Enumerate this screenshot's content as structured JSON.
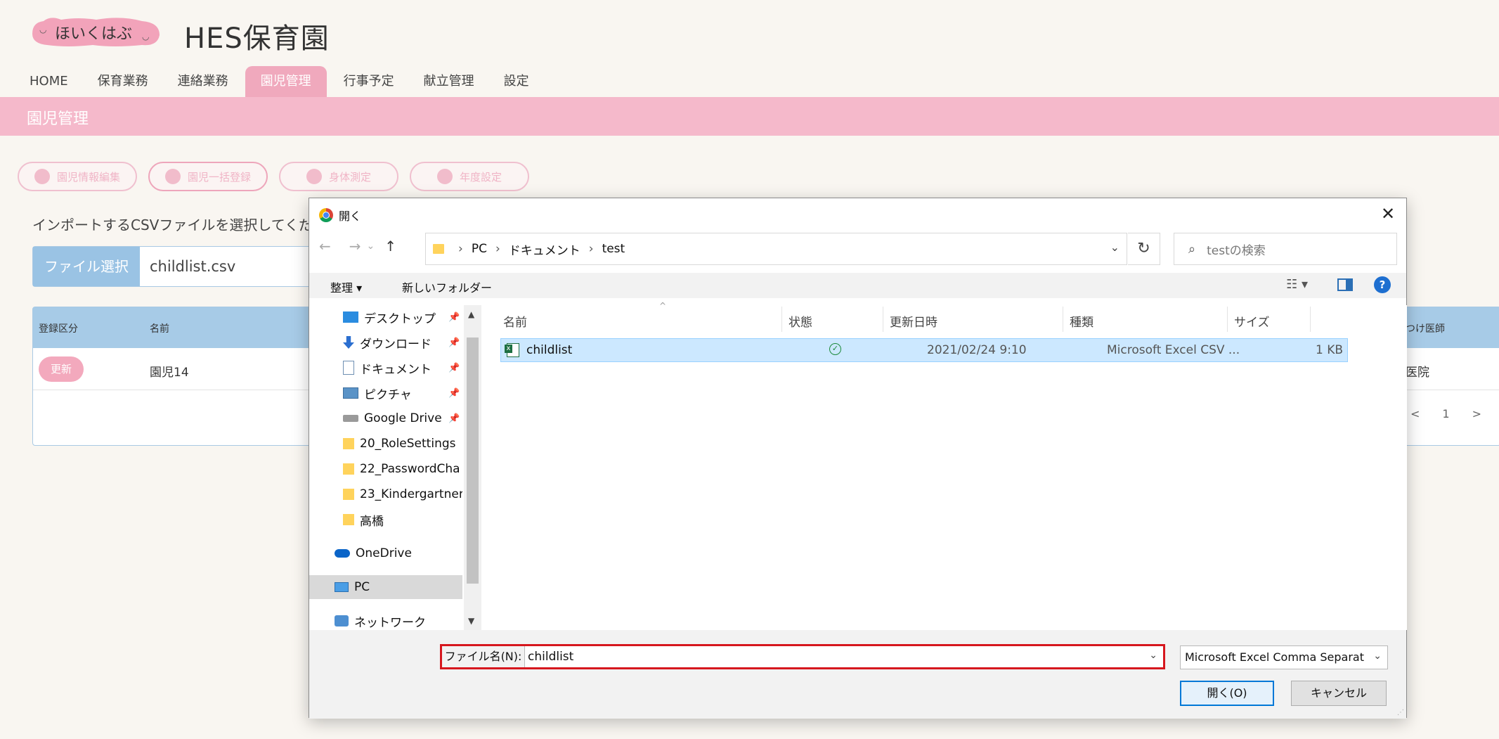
{
  "app": {
    "logo_text": "ほいくはぶ",
    "site_name": "HES保育園",
    "nav": [
      "HOME",
      "保育業務",
      "連絡業務",
      "園児管理",
      "行事予定",
      "献立管理",
      "設定"
    ],
    "active_nav": "園児管理",
    "page_title": "園児管理",
    "subtabs": [
      "園児情報編集",
      "園児一括登録",
      "身体測定",
      "年度設定"
    ],
    "import_message": "インポートするCSVファイルを選択してくだ",
    "file_select_label": "ファイル選択",
    "file_name": "childlist.csv",
    "table": {
      "headers": [
        "登録区分",
        "名前",
        "つけ医師"
      ],
      "row": {
        "badge": "更新",
        "name": "園児14",
        "doctor": "医院"
      }
    },
    "pager": {
      "prev": "<",
      "page": "1",
      "next": ">",
      "last": ">"
    }
  },
  "dialog": {
    "title": "開く",
    "close": "✕",
    "nav": {
      "back": "←",
      "forward": "→",
      "recent": "⌄",
      "up": "↑"
    },
    "address": [
      "PC",
      "ドキュメント",
      "test"
    ],
    "search_placeholder": "testの検索",
    "toolbar": {
      "organize": "整理 ▾",
      "new_folder": "新しいフォルダー",
      "help": "?"
    },
    "tree": [
      {
        "label": "デスクトップ",
        "icon": "desktop-icon",
        "pinned": true
      },
      {
        "label": "ダウンロード",
        "icon": "download-icon",
        "pinned": true
      },
      {
        "label": "ドキュメント",
        "icon": "documents-icon",
        "pinned": true
      },
      {
        "label": "ピクチャ",
        "icon": "pictures-icon",
        "pinned": true
      },
      {
        "label": "Google Drive",
        "icon": "drive-icon",
        "pinned": true
      },
      {
        "label": "20_RoleSettings",
        "icon": "folder-icon",
        "pinned": false
      },
      {
        "label": "22_PasswordCha",
        "icon": "folder-icon",
        "pinned": false
      },
      {
        "label": "23_Kindergartner",
        "icon": "folder-icon",
        "pinned": false
      },
      {
        "label": "高橋",
        "icon": "folder-icon",
        "pinned": false
      },
      {
        "label": "OneDrive",
        "icon": "onedrive-icon",
        "pinned": false
      },
      {
        "label": "PC",
        "icon": "pc-icon",
        "pinned": false
      },
      {
        "label": "ネットワーク",
        "icon": "network-icon",
        "pinned": false
      }
    ],
    "columns": [
      "名前",
      "状態",
      "更新日時",
      "種類",
      "サイズ"
    ],
    "files": [
      {
        "name": "childlist",
        "status": "✓",
        "modified": "2021/02/24 9:10",
        "type": "Microsoft Excel CSV ...",
        "size": "1 KB"
      }
    ],
    "filename_label": "ファイル名(N):",
    "filename_value": "childlist",
    "file_type": "Microsoft Excel Comma Separat",
    "open_button": "開く(O)",
    "cancel_button": "キャンセル"
  },
  "colors": {
    "pink": "#f5b9cb",
    "blue": "#a7cbe7",
    "highlight": "#d6171e",
    "selection": "#cce8ff"
  }
}
